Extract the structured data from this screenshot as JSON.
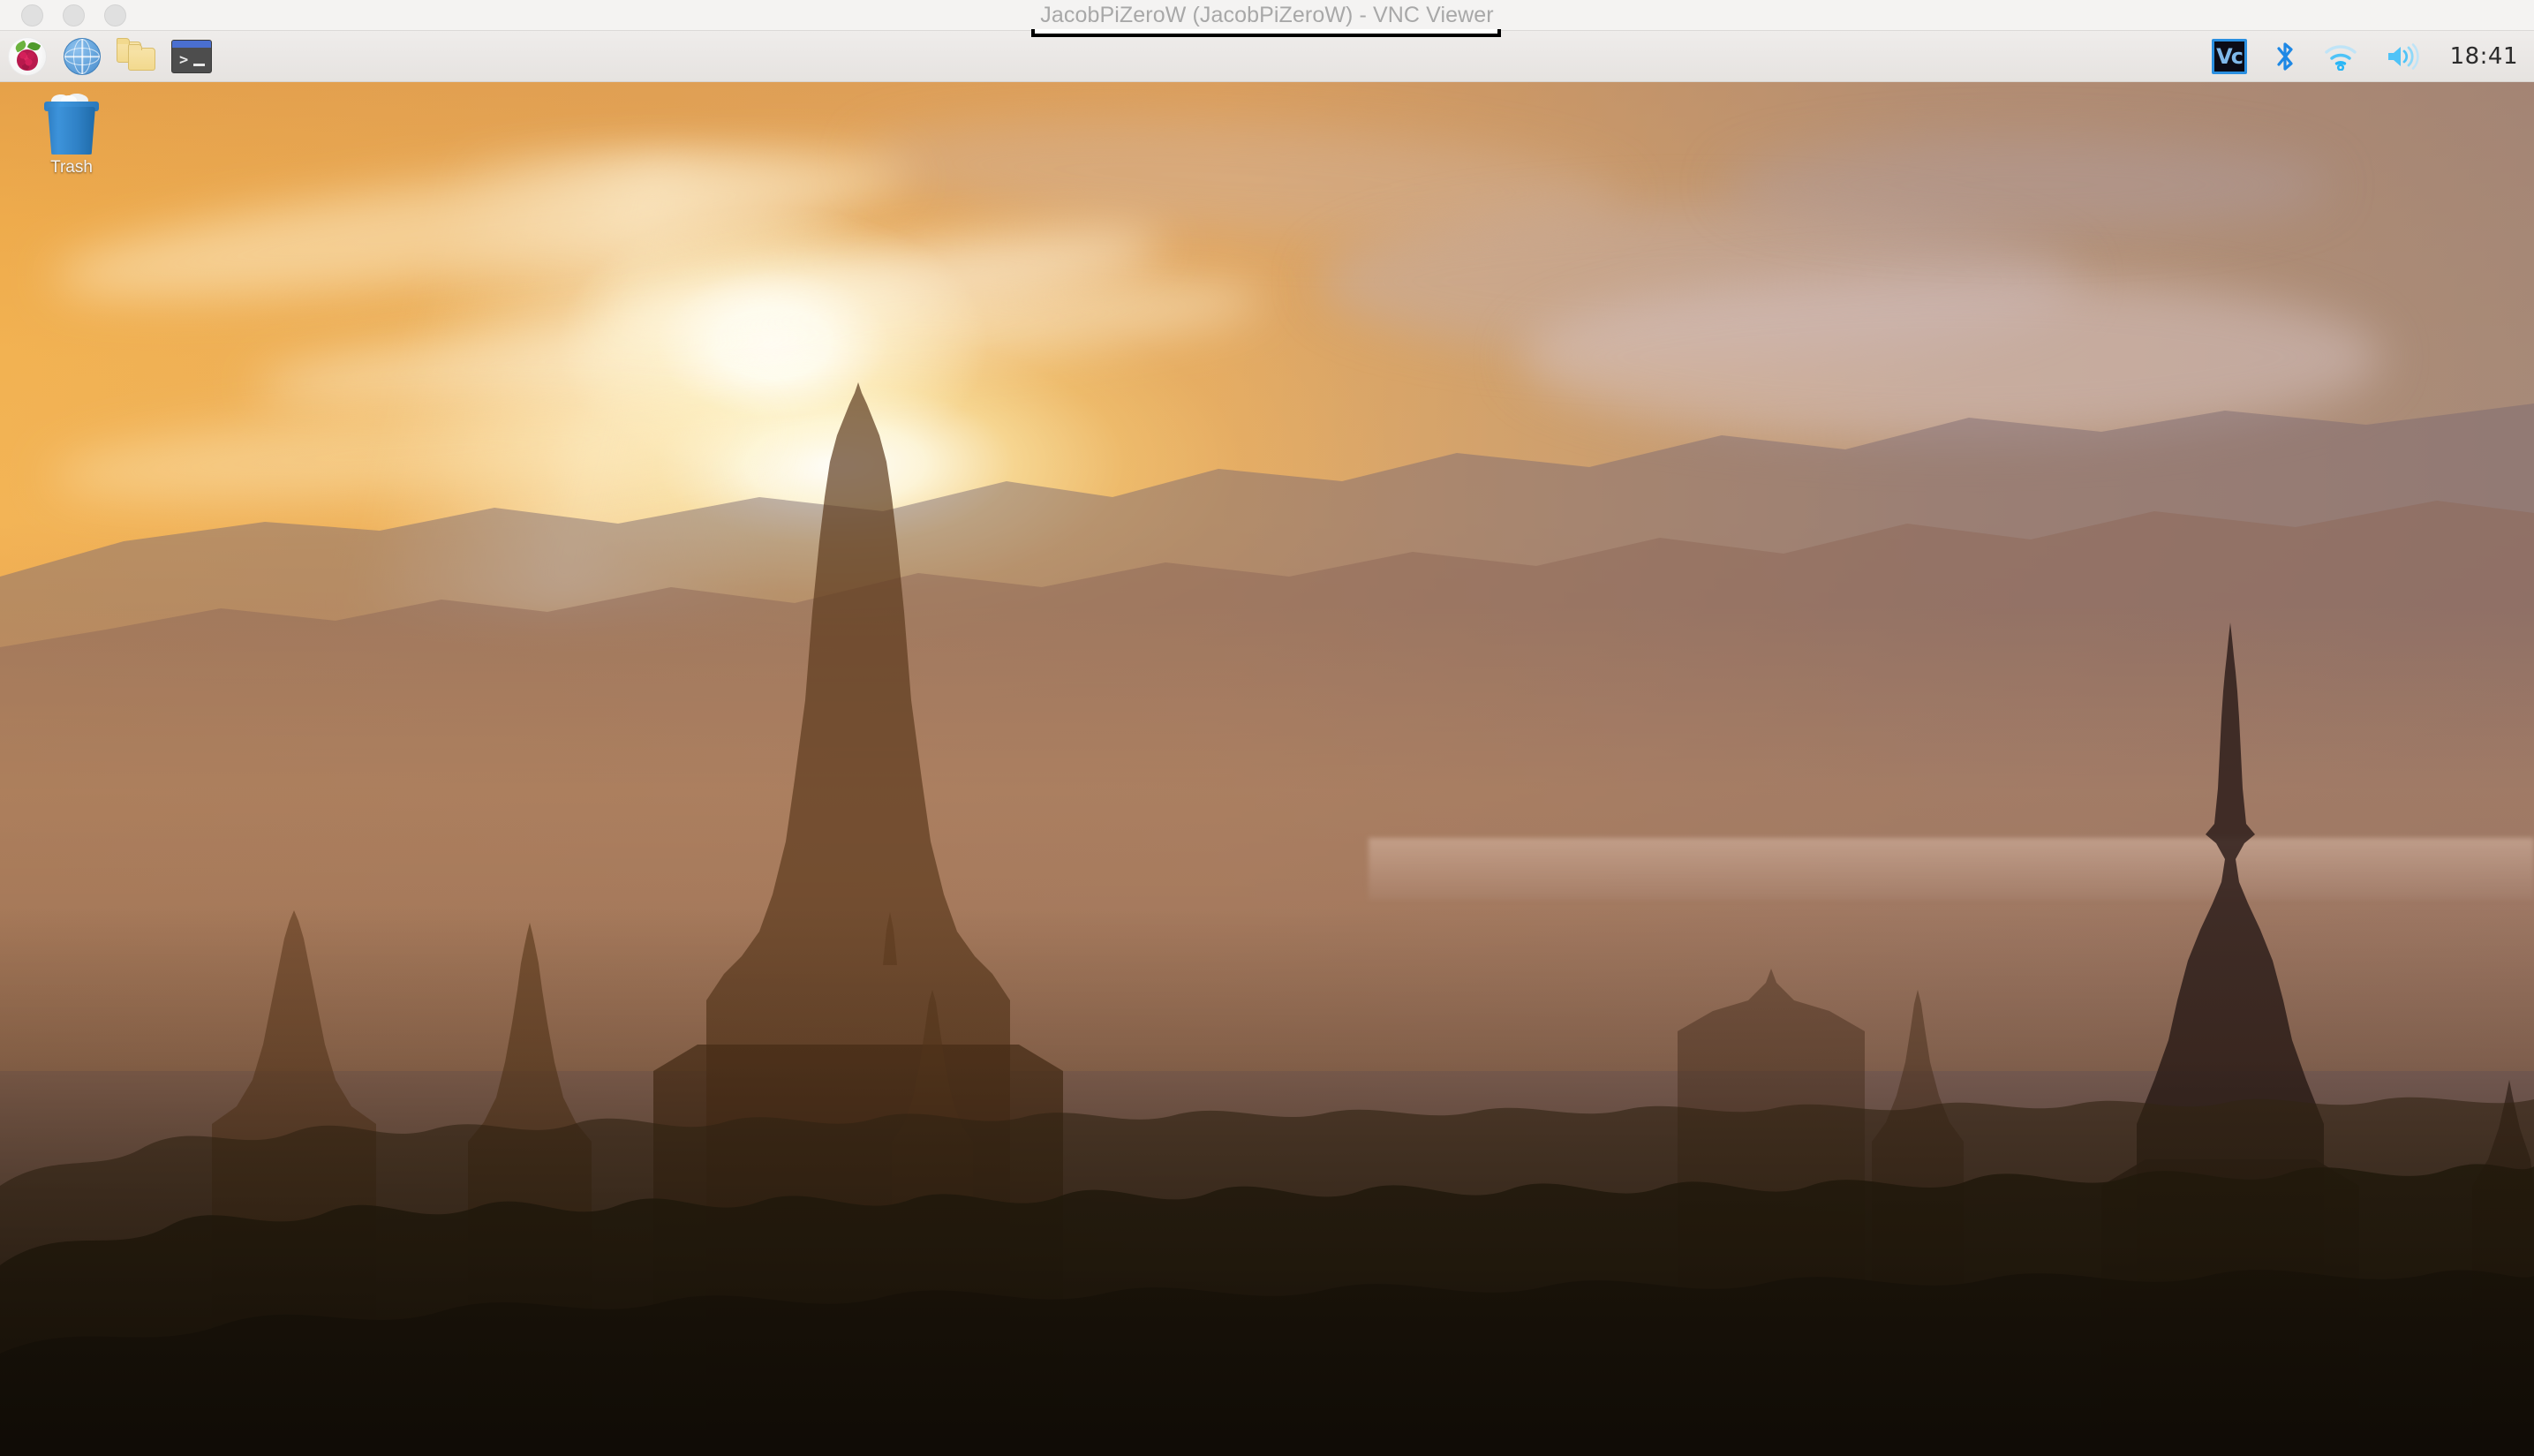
{
  "window": {
    "title": "JacobPiZeroW (JacobPiZeroW) - VNC Viewer",
    "controls": [
      {
        "name": "close",
        "label": "",
        "state": "inactive",
        "color": "#e0e0e0"
      },
      {
        "name": "minimize",
        "label": "",
        "state": "inactive",
        "color": "#e0e0e0"
      },
      {
        "name": "zoom",
        "label": "",
        "state": "inactive",
        "color": "#e0e0e0"
      }
    ],
    "toolbar_tab": {
      "visible": true,
      "fill": "#ffffff",
      "border": "#000000"
    }
  },
  "taskbar": {
    "background": "#eae7e5",
    "launchers": [
      {
        "icon": "raspberry-pi-menu-icon",
        "label": "Raspberry Pi Menu"
      },
      {
        "icon": "web-browser-icon",
        "label": "Web Browser"
      },
      {
        "icon": "file-manager-icon",
        "label": "File Manager"
      },
      {
        "icon": "terminal-icon",
        "label": "Terminal"
      }
    ],
    "tray": [
      {
        "icon": "vnc-server-icon",
        "label": "VNC Server",
        "accent": "#2a8fe0",
        "glyph": "Vc"
      },
      {
        "icon": "bluetooth-icon",
        "label": "Bluetooth",
        "accent": "#2196f3"
      },
      {
        "icon": "wifi-icon",
        "label": "Wireless Network",
        "accent": "#4fc3f7"
      },
      {
        "icon": "volume-icon",
        "label": "Volume",
        "accent": "#4fc3f7"
      }
    ],
    "clock": "18:41"
  },
  "desktop": {
    "wallpaper_name": "bagan-sunset-temples",
    "icons": [
      {
        "name": "trash-icon",
        "label": "Trash",
        "can_color": "#2f81c6"
      }
    ]
  }
}
